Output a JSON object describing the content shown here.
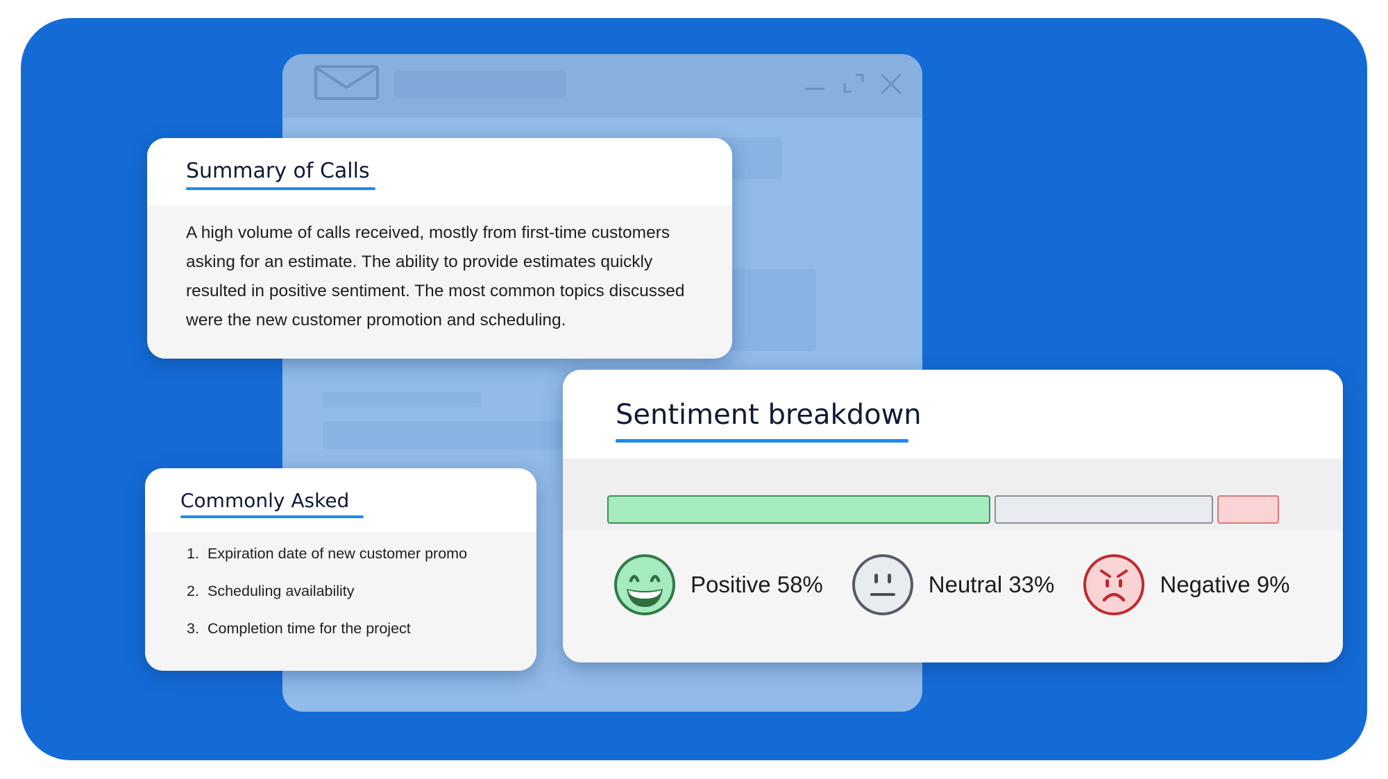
{
  "window": {
    "controls": {
      "minimize": "minimize",
      "maximize": "maximize",
      "close": "close"
    }
  },
  "summary": {
    "title": "Summary of Calls",
    "body": "A high volume of calls received, mostly from first-time customers asking for an estimate. The ability to provide estimates quickly resulted in positive sentiment. The most common topics discussed were the new customer promotion and scheduling."
  },
  "commonly_asked": {
    "title": "Commonly Asked",
    "items": [
      {
        "num": "1.",
        "text": "Expiration date of new customer promo"
      },
      {
        "num": "2.",
        "text": "Scheduling availability"
      },
      {
        "num": "3.",
        "text": "Completion time for the project"
      }
    ]
  },
  "sentiment": {
    "title": "Sentiment breakdown",
    "segments": [
      {
        "name": "Positive",
        "percent": 58,
        "label": "Positive 58%",
        "icon": "grinning-face-icon",
        "fill": "#a6eabf",
        "stroke": "#3f8f5a",
        "face_fill": "#a6eabf",
        "face_stroke": "#2f7a45"
      },
      {
        "name": "Neutral",
        "percent": 33,
        "label": "Neutral 33%",
        "icon": "neutral-face-icon",
        "fill": "#e8ebf0",
        "stroke": "#8a8f98",
        "face_fill": "#e8ebf0",
        "face_stroke": "#555b66"
      },
      {
        "name": "Negative",
        "percent": 9,
        "label": "Negative 9%",
        "icon": "angry-face-icon",
        "fill": "#fad3d5",
        "stroke": "#d9777c",
        "face_fill": "#fad3d5",
        "face_stroke": "#c02a30"
      }
    ]
  }
}
